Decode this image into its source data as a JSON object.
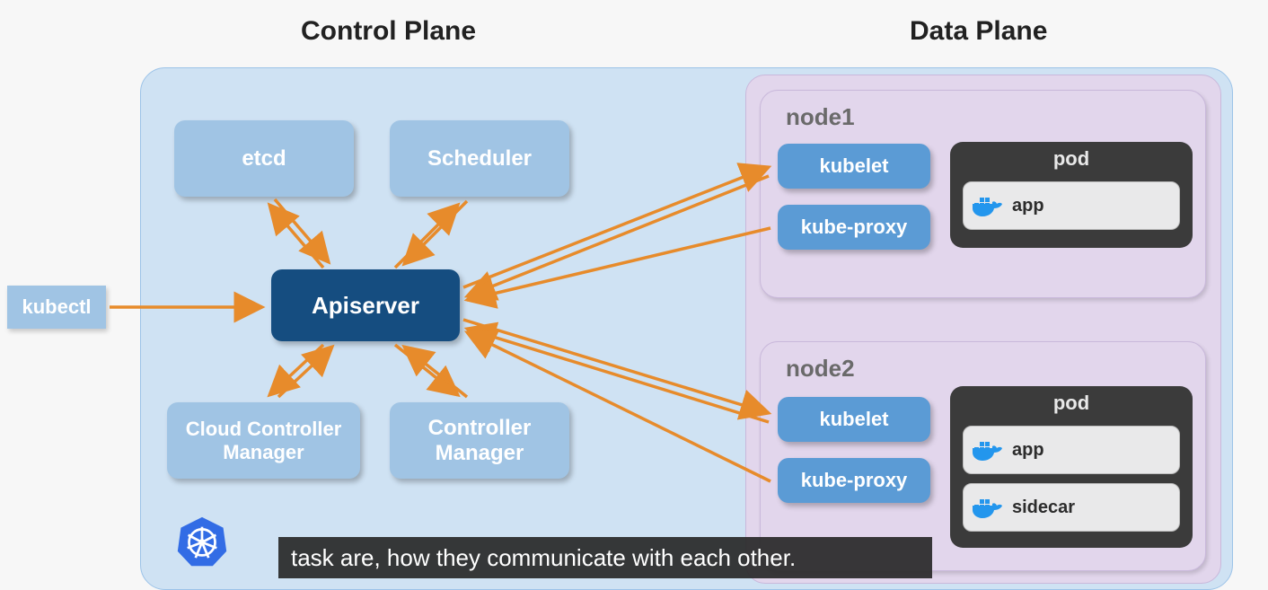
{
  "headings": {
    "control": "Control Plane",
    "data": "Data Plane"
  },
  "kubectl": "kubectl",
  "control": {
    "etcd": "etcd",
    "scheduler": "Scheduler",
    "apiserver": "Apiserver",
    "ccm": "Cloud Controller\nManager",
    "cm": "Controller\nManager"
  },
  "nodes": {
    "n1": {
      "title": "node1",
      "kubelet": "kubelet",
      "kubeproxy": "kube-proxy",
      "pod": {
        "title": "pod",
        "apps": [
          "app"
        ]
      }
    },
    "n2": {
      "title": "node2",
      "kubelet": "kubelet",
      "kubeproxy": "kube-proxy",
      "pod": {
        "title": "pod",
        "apps": [
          "app",
          "sidecar"
        ]
      }
    }
  },
  "caption": "task are, how they communicate with each other.",
  "colors": {
    "arrow": "#e78b2b"
  }
}
